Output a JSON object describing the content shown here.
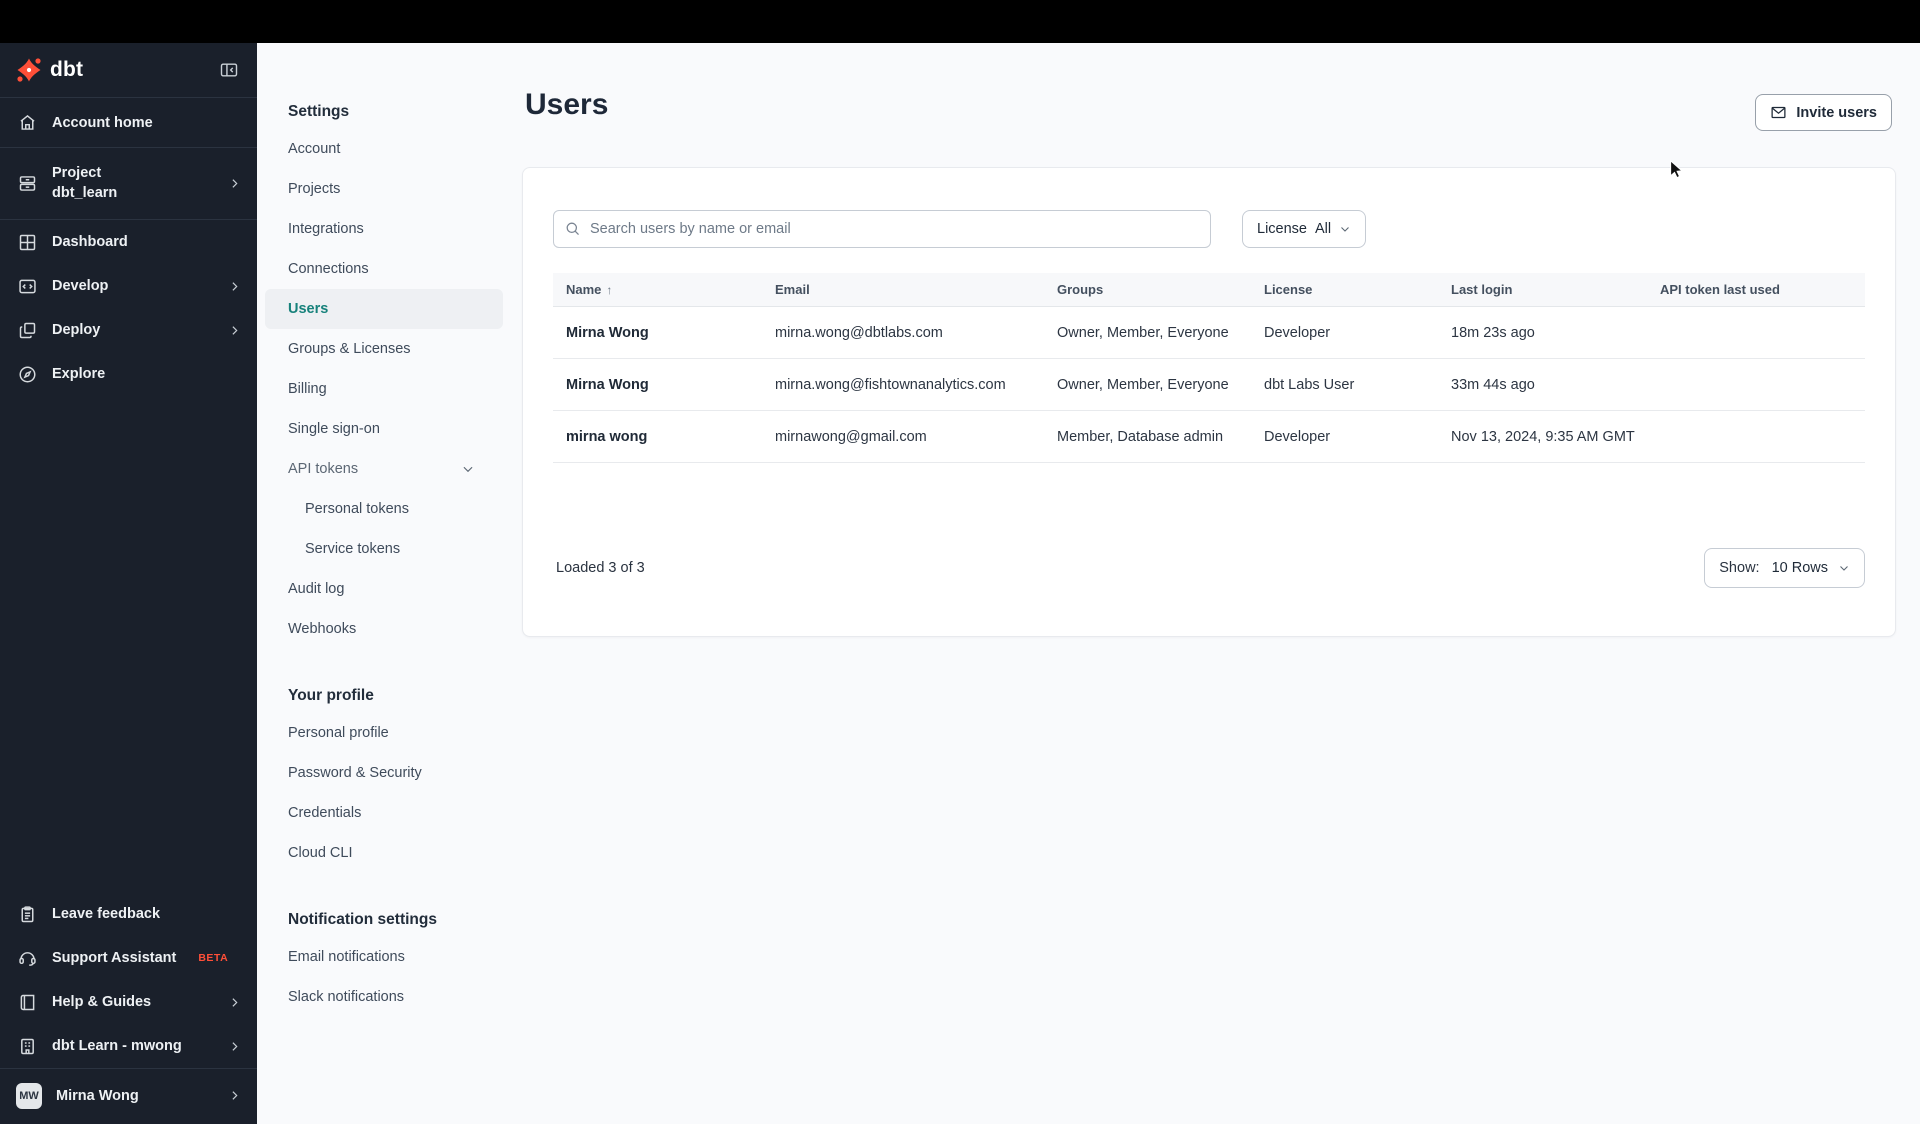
{
  "sidebar": {
    "logo_text": "dbt",
    "items": [
      {
        "label": "Account home",
        "icon": "home-icon"
      },
      {
        "label": "Project",
        "sublabel": "dbt_learn",
        "icon": "project-icon"
      },
      {
        "label": "Dashboard",
        "icon": "dashboard-icon"
      },
      {
        "label": "Develop",
        "icon": "develop-icon"
      },
      {
        "label": "Deploy",
        "icon": "deploy-icon"
      },
      {
        "label": "Explore",
        "icon": "explore-icon"
      }
    ],
    "footer_items": [
      {
        "label": "Leave feedback",
        "icon": "clipboard-icon"
      },
      {
        "label": "Support Assistant",
        "badge": "BETA",
        "icon": "headset-icon"
      },
      {
        "label": "Help & Guides",
        "icon": "book-icon"
      },
      {
        "label": "dbt Learn - mwong",
        "icon": "building-icon"
      }
    ],
    "user": {
      "name": "Mirna Wong",
      "initials": "MW"
    }
  },
  "settings_nav": {
    "sections": [
      {
        "heading": "Settings",
        "items": [
          {
            "label": "Account"
          },
          {
            "label": "Projects"
          },
          {
            "label": "Integrations"
          },
          {
            "label": "Connections"
          },
          {
            "label": "Users"
          },
          {
            "label": "Groups & Licenses"
          },
          {
            "label": "Billing"
          },
          {
            "label": "Single sign-on"
          },
          {
            "label": "API tokens"
          },
          {
            "label": "Personal tokens"
          },
          {
            "label": "Service tokens"
          },
          {
            "label": "Audit log"
          },
          {
            "label": "Webhooks"
          }
        ]
      },
      {
        "heading": "Your profile",
        "items": [
          {
            "label": "Personal profile"
          },
          {
            "label": "Password & Security"
          },
          {
            "label": "Credentials"
          },
          {
            "label": "Cloud CLI"
          }
        ]
      },
      {
        "heading": "Notification settings",
        "items": [
          {
            "label": "Email notifications"
          },
          {
            "label": "Slack notifications"
          }
        ]
      }
    ]
  },
  "main": {
    "title": "Users",
    "invite_button_label": "Invite users",
    "search": {
      "placeholder": "Search users by name or email"
    },
    "license_filter": {
      "label": "License",
      "value": "All"
    },
    "table": {
      "columns": [
        "Name",
        "Email",
        "Groups",
        "License",
        "Last login",
        "API token last used"
      ],
      "sort_indicator": "↑",
      "rows": [
        {
          "name": "Mirna Wong",
          "email": "mirna.wong@dbtlabs.com",
          "groups": "Owner, Member, Everyone",
          "license": "Developer",
          "last_login": "18m 23s ago",
          "api_token_last_used": ""
        },
        {
          "name": "Mirna Wong",
          "email": "mirna.wong@fishtownanalytics.com",
          "groups": "Owner, Member, Everyone",
          "license": "dbt Labs User",
          "last_login": "33m 44s ago",
          "api_token_last_used": ""
        },
        {
          "name": "mirna wong",
          "email": "mirnawong@gmail.com",
          "groups": "Member, Database admin",
          "license": "Developer",
          "last_login": "Nov 13, 2024, 9:35 AM GMT",
          "api_token_last_used": ""
        }
      ]
    },
    "footer": {
      "loaded_text": "Loaded 3 of 3",
      "show_label": "Show:",
      "show_value": "10 Rows"
    }
  },
  "colors": {
    "brand_orange": "#ff4f38",
    "active_teal": "#17827b",
    "sidebar_bg": "#1a202b",
    "topbar_black": "#000000"
  }
}
